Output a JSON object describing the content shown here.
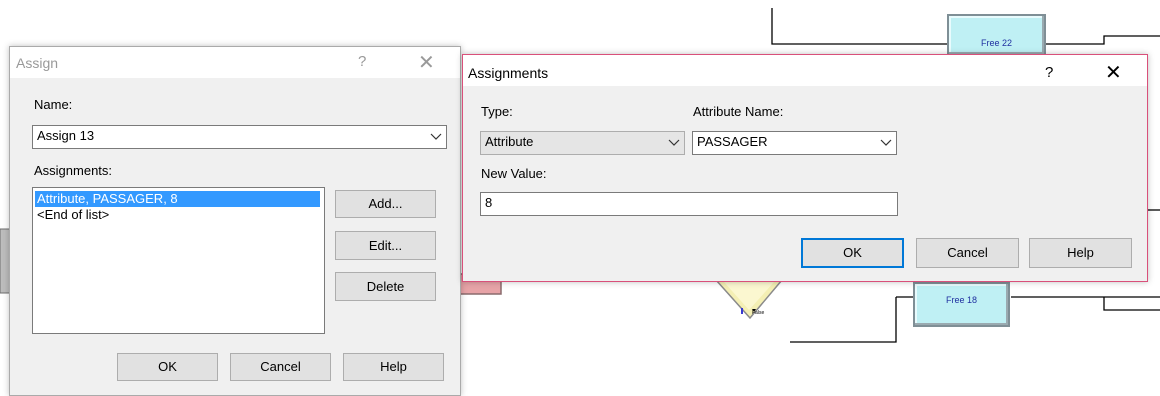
{
  "background": {
    "modules": [
      {
        "label": "Free 22"
      },
      {
        "label": "Free 18"
      }
    ],
    "decision_false_label": "False"
  },
  "assign_dialog": {
    "title": "Assign",
    "help_glyph": "?",
    "close_glyph": "✕",
    "name_label": "Name:",
    "name_value": "Assign 13",
    "assignments_label": "Assignments:",
    "assignments_items": [
      "Attribute, PASSAGER, 8",
      "<End of list>"
    ],
    "add_label": "Add...",
    "edit_label": "Edit...",
    "delete_label": "Delete",
    "ok_label": "OK",
    "cancel_label": "Cancel",
    "help_label": "Help"
  },
  "assignments_dialog": {
    "title": "Assignments",
    "help_glyph": "?",
    "close_glyph": "✕",
    "type_label": "Type:",
    "type_value": "Attribute",
    "attribute_name_label": "Attribute Name:",
    "attribute_name_value": "PASSAGER",
    "new_value_label": "New Value:",
    "new_value_value": "8",
    "ok_label": "OK",
    "cancel_label": "Cancel",
    "help_label": "Help",
    "accent_color": "#d9507a",
    "default_button_color": "#0078d7"
  }
}
